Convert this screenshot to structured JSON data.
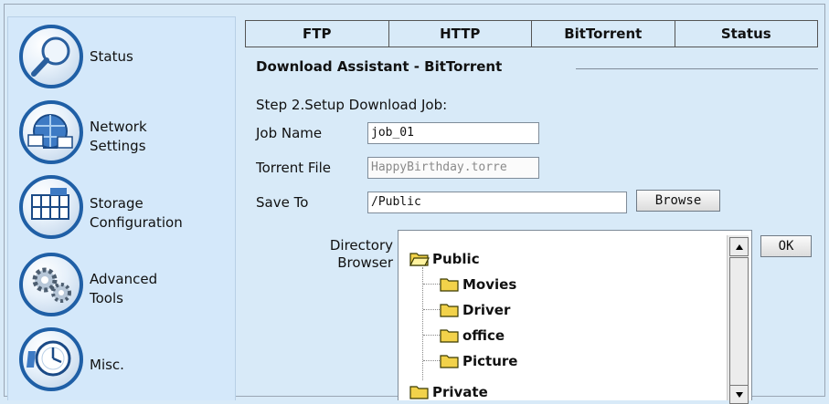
{
  "sidebar": {
    "items": [
      {
        "label_lines": [
          "Status"
        ],
        "icon": "magnifier-icon"
      },
      {
        "label_lines": [
          "Network",
          "Settings"
        ],
        "icon": "network-icon"
      },
      {
        "label_lines": [
          "Storage",
          "Configuration"
        ],
        "icon": "storage-icon"
      },
      {
        "label_lines": [
          "Advanced",
          "Tools"
        ],
        "icon": "gears-icon"
      },
      {
        "label_lines": [
          "Misc."
        ],
        "icon": "clock-icon"
      }
    ]
  },
  "tabs": [
    "FTP",
    "HTTP",
    "BitTorrent",
    "Status"
  ],
  "section_title": "Download Assistant - BitTorrent",
  "step_text": "Step 2.Setup Download Job:",
  "form": {
    "job_name_label": "Job Name",
    "job_name_value": "job_01",
    "torrent_label": "Torrent File",
    "torrent_value": "HappyBirthday.torre",
    "save_to_label": "Save To",
    "save_to_value": "/Public",
    "browse_label": "Browse",
    "dir_label_lines": [
      "Directory",
      "Browser"
    ],
    "ok_label": "OK"
  },
  "tree": {
    "nodes": [
      {
        "label": "Public",
        "level": 0
      },
      {
        "label": "Movies",
        "level": 1
      },
      {
        "label": "Driver",
        "level": 1
      },
      {
        "label": "office",
        "level": 1
      },
      {
        "label": "Picture",
        "level": 1
      },
      {
        "label": "Private",
        "level": 0
      }
    ]
  },
  "colors": {
    "icon_ring": "#1f5fa6",
    "folder": "#f2d24a",
    "page_bg": "#d8eaf8"
  }
}
